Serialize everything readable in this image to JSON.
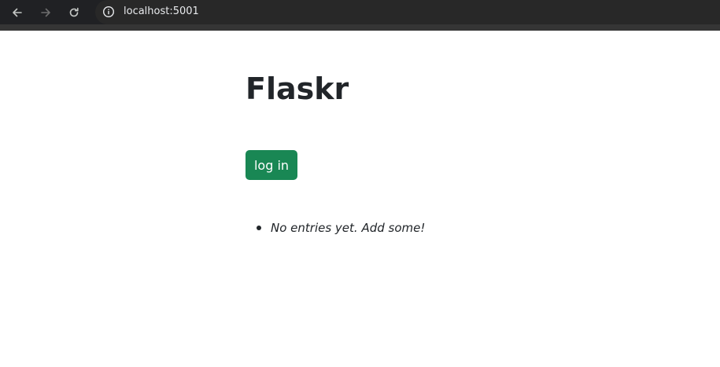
{
  "browser": {
    "url": "localhost:5001",
    "icons": {
      "back": "arrow-left-icon",
      "forward": "arrow-right-icon",
      "reload": "reload-icon",
      "site_info": "info-icon"
    }
  },
  "page": {
    "title": "Flaskr",
    "login_label": "log in",
    "entries": [
      "No entries yet. Add some!"
    ]
  },
  "colors": {
    "button_bg": "#198754",
    "text": "#212529",
    "browser_bar": "#202124"
  }
}
